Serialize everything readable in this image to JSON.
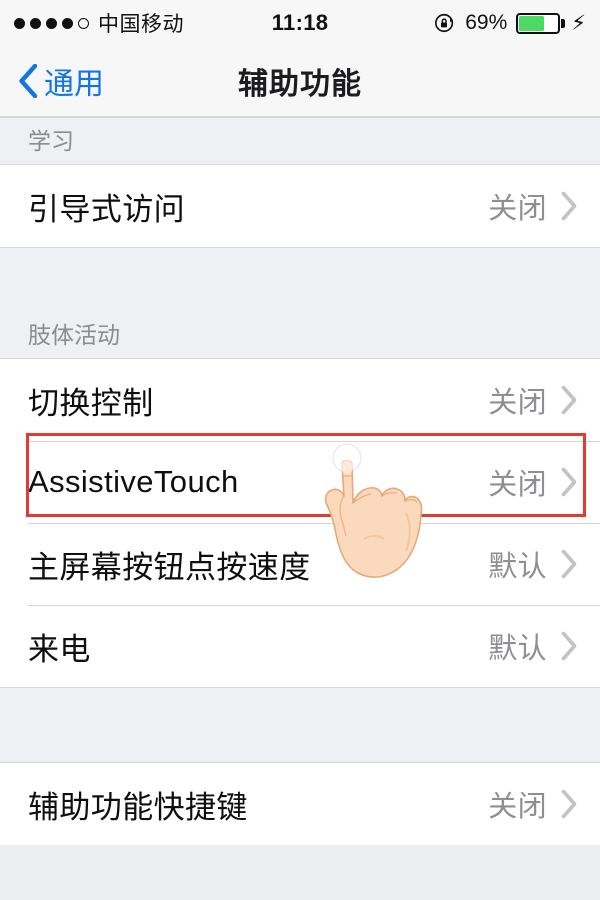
{
  "status_bar": {
    "signal_dots_filled": 4,
    "signal_dots_total": 5,
    "carrier": "中国移动",
    "time": "11:18",
    "rotation_lock_icon": "rotation-lock-icon",
    "battery_percent": "69%",
    "battery_level": 69,
    "battery_fill_color": "#4cd964",
    "charging_icon": "⚡"
  },
  "nav_bar": {
    "back_icon": "chevron-left-icon",
    "back_label": "通用",
    "title": "辅助功能"
  },
  "accent_color": "#1175e8",
  "highlight_color": "#e23b30",
  "sections": [
    {
      "header": "学习",
      "rows": [
        {
          "label": "引导式访问",
          "value": "关闭",
          "highlighted": false
        }
      ]
    },
    {
      "header": "肢体活动",
      "rows": [
        {
          "label": "切换控制",
          "value": "关闭",
          "highlighted": false
        },
        {
          "label": "AssistiveTouch",
          "value": "关闭",
          "highlighted": true
        },
        {
          "label": "主屏幕按钮点按速度",
          "value": "默认",
          "highlighted": false
        },
        {
          "label": "来电",
          "value": "默认",
          "highlighted": false
        }
      ]
    },
    {
      "header": "",
      "rows": [
        {
          "label": "辅助功能快捷键",
          "value": "关闭",
          "highlighted": false
        }
      ]
    }
  ],
  "overlay": {
    "hand_cursor_icon": "pointing-hand-cursor",
    "tap_ripple": "tap-ripple-circle"
  }
}
